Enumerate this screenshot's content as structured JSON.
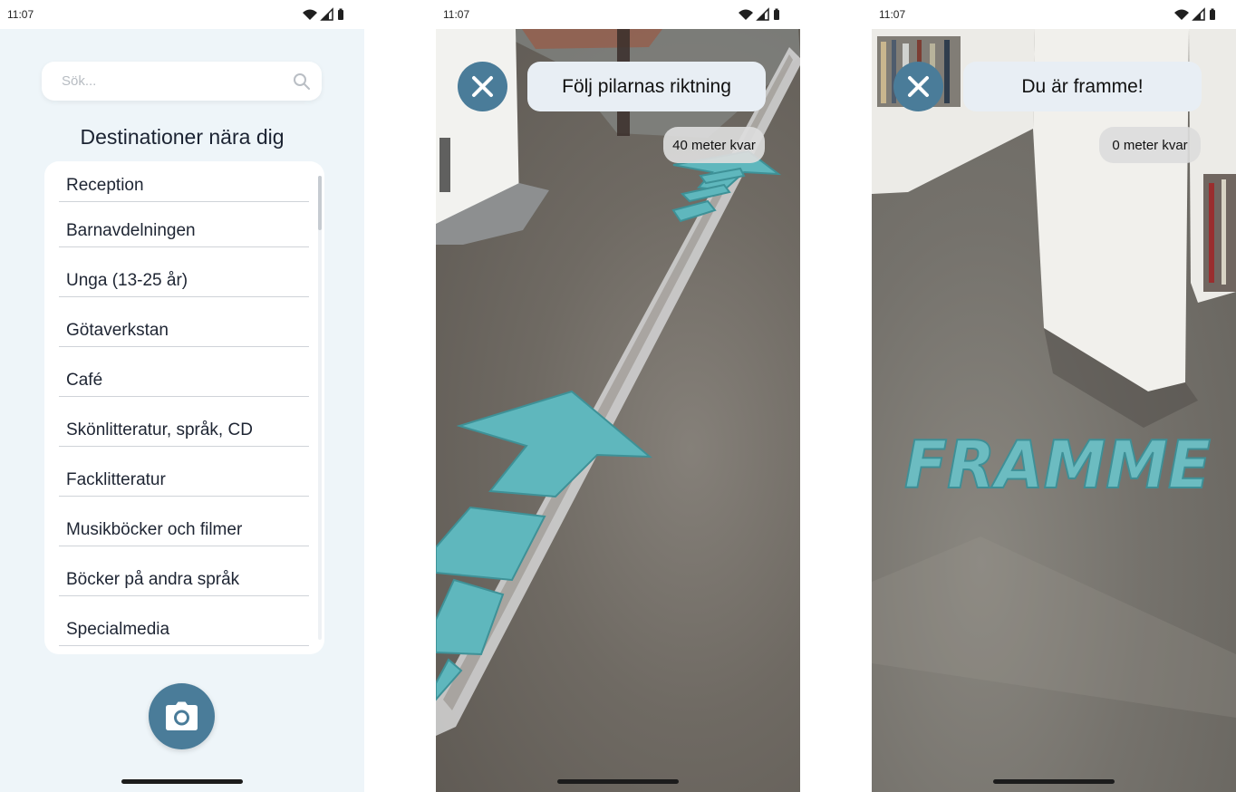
{
  "status_bar": {
    "time": "11:07"
  },
  "list_screen": {
    "search": {
      "placeholder": "Sök..."
    },
    "section_title": "Destinationer nära dig",
    "destinations": [
      "Reception",
      "Barnavdelningen",
      "Unga (13-25 år)",
      "Götaverkstan",
      "Café",
      "Skönlitteratur, språk, CD",
      "Facklitteratur",
      "Musikböcker och filmer",
      "Böcker på andra språk",
      "Specialmedia"
    ]
  },
  "navigation_screen": {
    "instruction": "Följ pilarnas riktning",
    "distance": "40 meter kvar"
  },
  "arrival_screen": {
    "instruction": "Du är framme!",
    "distance": "0 meter kvar",
    "ar_label": "FRAMME"
  },
  "colors": {
    "accent": "#4a7c99",
    "list_background": "#eef5f9",
    "ar_arrow": "#5fb7bd",
    "pill_background": "#e8eef4"
  }
}
